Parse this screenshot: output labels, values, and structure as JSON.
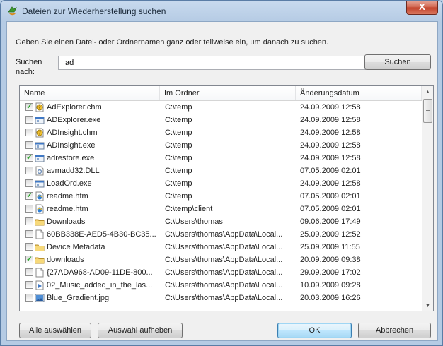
{
  "window": {
    "title": "Dateien zur Wiederherstellung suchen",
    "close_label": "X"
  },
  "instruction": "Geben Sie einen Datei- oder Ordnernamen ganz oder teilweise ein, um danach zu suchen.",
  "search": {
    "label": "Suchen nach:",
    "value": "ad",
    "button_label": "Suchen"
  },
  "columns": {
    "name": "Name",
    "folder": "Im Ordner",
    "date": "Änderungsdatum"
  },
  "rows": [
    {
      "name": "AdExplorer.chm",
      "folder": "C:\\temp",
      "date": "24.09.2009 12:58",
      "checked": true,
      "icon": "help-file-icon"
    },
    {
      "name": "ADExplorer.exe",
      "folder": "C:\\temp",
      "date": "24.09.2009 12:58",
      "checked": false,
      "icon": "exe-icon"
    },
    {
      "name": "ADInsight.chm",
      "folder": "C:\\temp",
      "date": "24.09.2009 12:58",
      "checked": false,
      "icon": "help-file-icon"
    },
    {
      "name": "ADInsight.exe",
      "folder": "C:\\temp",
      "date": "24.09.2009 12:58",
      "checked": false,
      "icon": "exe-icon"
    },
    {
      "name": "adrestore.exe",
      "folder": "C:\\temp",
      "date": "24.09.2009 12:58",
      "checked": true,
      "icon": "exe-icon"
    },
    {
      "name": "avmadd32.DLL",
      "folder": "C:\\temp",
      "date": "07.05.2009 02:01",
      "checked": false,
      "icon": "dll-icon"
    },
    {
      "name": "LoadOrd.exe",
      "folder": "C:\\temp",
      "date": "24.09.2009 12:58",
      "checked": false,
      "icon": "exe-icon"
    },
    {
      "name": "readme.htm",
      "folder": "C:\\temp",
      "date": "07.05.2009 02:01",
      "checked": true,
      "icon": "html-file-icon"
    },
    {
      "name": "readme.htm",
      "folder": "C:\\temp\\client",
      "date": "07.05.2009 02:01",
      "checked": false,
      "icon": "html-file-icon"
    },
    {
      "name": "Downloads",
      "folder": "C:\\Users\\thomas",
      "date": "09.06.2009 17:49",
      "checked": false,
      "icon": "folder-icon"
    },
    {
      "name": "60BB338E-AED5-4B30-BC35...",
      "folder": "C:\\Users\\thomas\\AppData\\Local...",
      "date": "25.09.2009 12:52",
      "checked": false,
      "icon": "blank-file-icon"
    },
    {
      "name": "Device Metadata",
      "folder": "C:\\Users\\thomas\\AppData\\Local...",
      "date": "25.09.2009 11:55",
      "checked": false,
      "icon": "folder-icon"
    },
    {
      "name": "downloads",
      "folder": "C:\\Users\\thomas\\AppData\\Local...",
      "date": "20.09.2009 09:38",
      "checked": true,
      "icon": "folder-icon"
    },
    {
      "name": "{27ADA968-AD09-11DE-800...",
      "folder": "C:\\Users\\thomas\\AppData\\Local...",
      "date": "29.09.2009 17:02",
      "checked": false,
      "icon": "blank-file-icon"
    },
    {
      "name": "02_Music_added_in_the_las...",
      "folder": "C:\\Users\\thomas\\AppData\\Local...",
      "date": "10.09.2009 09:28",
      "checked": false,
      "icon": "playlist-icon"
    },
    {
      "name": "Blue_Gradient.jpg",
      "folder": "C:\\Users\\thomas\\AppData\\Local...",
      "date": "20.03.2009 16:26",
      "checked": false,
      "icon": "image-file-icon"
    }
  ],
  "buttons": {
    "select_all": "Alle auswählen",
    "deselect": "Auswahl aufheben",
    "ok": "OK",
    "cancel": "Abbrechen"
  },
  "colors": {
    "window_frame": "#b5cbe4",
    "accent_button": "#3c7fb1",
    "checkmark": "#21a121"
  }
}
